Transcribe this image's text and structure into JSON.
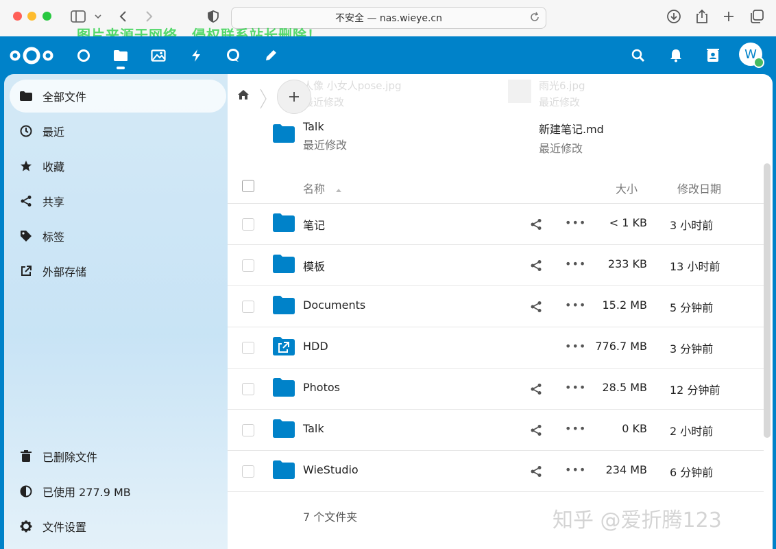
{
  "browser": {
    "address": "不安全 — nas.wieye.cn",
    "overlay_watermark": "图片来源于网络，侵权联系站长删除！"
  },
  "header": {
    "apps": [
      "dashboard",
      "files",
      "photos",
      "activity",
      "talk",
      "notes"
    ],
    "avatar_letter": "W"
  },
  "sidebar": {
    "items": [
      {
        "label": "全部文件",
        "icon": "folder-icon",
        "active": true
      },
      {
        "label": "最近",
        "icon": "clock-icon"
      },
      {
        "label": "收藏",
        "icon": "star-icon"
      },
      {
        "label": "共享",
        "icon": "share-icon"
      },
      {
        "label": "标签",
        "icon": "tag-icon"
      },
      {
        "label": "外部存储",
        "icon": "external-link-icon"
      }
    ],
    "bottom": {
      "trash": "已删除文件",
      "usage": "已使用 277.9 MB",
      "settings": "文件设置"
    }
  },
  "recent": {
    "cards": [
      {
        "name": "Talk",
        "sub": "最近修改"
      },
      {
        "name": "新建笔记.md",
        "sub": "最近修改"
      }
    ],
    "ghosts": [
      "人像 小女人pose.jpg",
      "最近修改",
      "雨光6.jpg",
      "最近修改"
    ]
  },
  "table": {
    "headers": {
      "name": "名称",
      "size": "大小",
      "date": "修改日期"
    },
    "rows": [
      {
        "name": "笔记",
        "size": "< 1 KB",
        "date": "3 小时前",
        "type": "folder",
        "shared": true
      },
      {
        "name": "模板",
        "size": "233 KB",
        "date": "13 小时前",
        "type": "folder",
        "shared": true
      },
      {
        "name": "Documents",
        "size": "15.2 MB",
        "date": "5 分钟前",
        "type": "folder",
        "shared": true
      },
      {
        "name": "HDD",
        "size": "776.7 MB",
        "date": "3 分钟前",
        "type": "external",
        "shared": false
      },
      {
        "name": "Photos",
        "size": "28.5 MB",
        "date": "12 分钟前",
        "type": "folder",
        "shared": true
      },
      {
        "name": "Talk",
        "size": "0 KB",
        "date": "2 小时前",
        "type": "folder",
        "shared": true
      },
      {
        "name": "WieStudio",
        "size": "234 MB",
        "date": "6 分钟前",
        "type": "folder",
        "shared": true
      }
    ],
    "footer": "7 个文件夹"
  },
  "watermark_bottom": "知乎 @爱折腾123",
  "colors": {
    "brand": "#0082c9",
    "folder": "#0082c9"
  }
}
